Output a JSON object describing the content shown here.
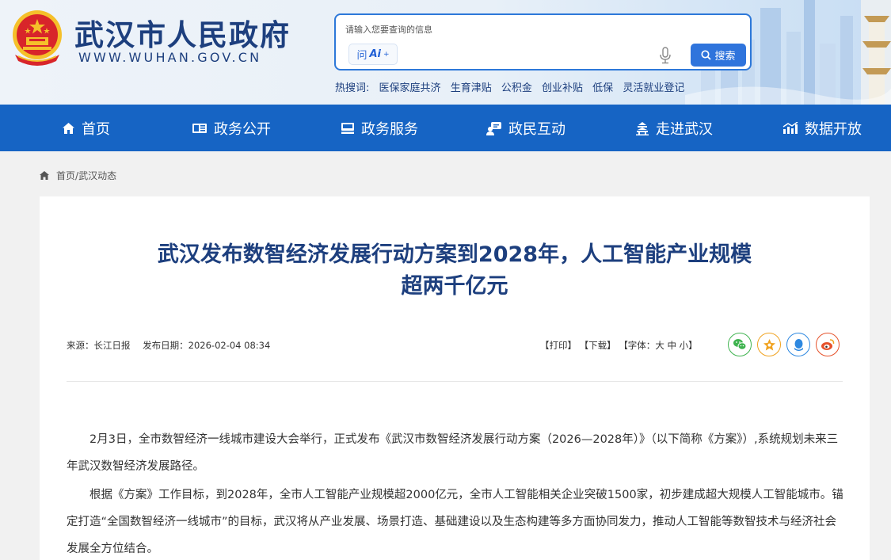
{
  "header": {
    "site_title": "武汉市人民政府",
    "site_url": "WWW.WUHAN.GOV.CN",
    "search": {
      "placeholder": "请输入您要查询的信息",
      "ai_label_prefix": "问",
      "ai_label": "Ai",
      "ai_sup": "+",
      "button_label": "搜索"
    },
    "hot_words": {
      "label": "热搜词:",
      "items": [
        "医保家庭共济",
        "生育津贴",
        "公积金",
        "创业补贴",
        "低保",
        "灵活就业登记"
      ]
    }
  },
  "nav": {
    "items": [
      {
        "label": "首页",
        "icon": "home-icon"
      },
      {
        "label": "政务公开",
        "icon": "news-icon"
      },
      {
        "label": "政务服务",
        "icon": "service-icon"
      },
      {
        "label": "政民互动",
        "icon": "chat-icon"
      },
      {
        "label": "走进武汉",
        "icon": "building-icon"
      },
      {
        "label": "数据开放",
        "icon": "chart-icon"
      }
    ]
  },
  "breadcrumb": {
    "home": "首页",
    "separator": "/",
    "current": "武汉动态"
  },
  "article": {
    "title_line1": "武汉发布数智经济发展行动方案到2028年，人工智能产业规模",
    "title_line2": "超两千亿元",
    "source": "来源：长江日报",
    "date": "发布日期：2026-02-04 08:34",
    "tools": {
      "print": "【打印】",
      "download": "【下载】",
      "font_label": "【字体：",
      "font_large": "大",
      "font_medium": "中",
      "font_small": "小",
      "font_close": "】"
    },
    "share_icons": [
      "wechat-icon",
      "favorite-icon",
      "qq-icon",
      "weibo-icon"
    ],
    "paragraphs": [
      "2月3日，全市数智经济一线城市建设大会举行，正式发布《武汉市数智经济发展行动方案（2026—2028年）》（以下简称《方案》）,系统规划未来三年武汉数智经济发展路径。",
      "根据《方案》工作目标，到2028年，全市人工智能产业规模超2000亿元，全市人工智能相关企业突破1500家，初步建成超大规模人工智能城市。锚定打造“全国数智经济一线城市”的目标，武汉将从产业发展、场景打造、基础建设以及生态构建等多方面协同发力，推动人工智能等数智技术与经济社会发展全方位结合。"
    ]
  },
  "colors": {
    "nav_bg": "#1664c4",
    "title": "#1d3f7e",
    "search_btn": "#2f74dc",
    "emblem_red": "#d8252a",
    "emblem_gold": "#f5c02a"
  }
}
